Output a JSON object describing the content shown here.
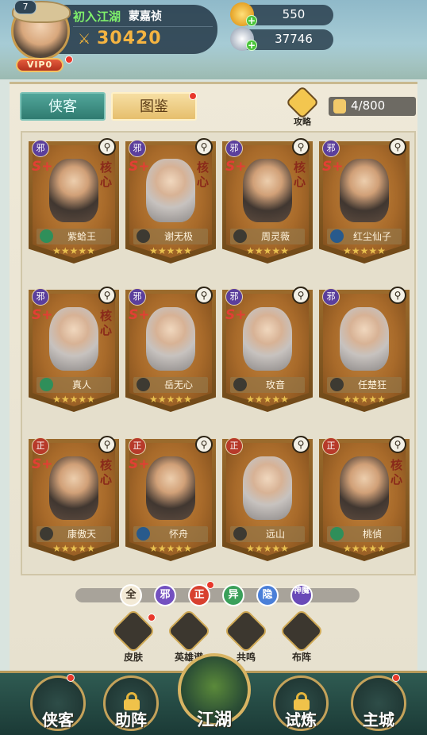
{
  "player": {
    "level": "7",
    "title": "初入江湖",
    "name": "蒙嘉祯",
    "power": "30420",
    "vip": "VIP0"
  },
  "resources": {
    "gold": "550",
    "silver": "37746"
  },
  "tabs": [
    {
      "label": "侠客",
      "active": false
    },
    {
      "label": "图鉴",
      "active": true
    }
  ],
  "guide_label": "攻略",
  "collection_count": "4/800",
  "heroes": [
    {
      "name": "紫蛤王",
      "faction": "邪",
      "grade": "S+",
      "core": "核心",
      "stars": "★★★★★"
    },
    {
      "name": "谢无极",
      "faction": "邪",
      "grade": "S+",
      "core": "核心",
      "stars": "★★★★★"
    },
    {
      "name": "周灵薇",
      "faction": "邪",
      "grade": "S+",
      "core": "核心",
      "stars": "★★★★★"
    },
    {
      "name": "红尘仙子",
      "faction": "邪",
      "grade": "S+",
      "core": "",
      "stars": "★★★★★"
    },
    {
      "name": "真人",
      "faction": "邪",
      "grade": "S+",
      "core": "核心",
      "stars": "★★★★★"
    },
    {
      "name": "岳无心",
      "faction": "邪",
      "grade": "S+",
      "core": "",
      "stars": "★★★★★"
    },
    {
      "name": "玫音",
      "faction": "邪",
      "grade": "S+",
      "core": "",
      "stars": "★★★★★"
    },
    {
      "name": "任楚狂",
      "faction": "邪",
      "grade": "",
      "core": "",
      "stars": "★★★★★"
    },
    {
      "name": "康傲天",
      "faction": "正",
      "grade": "S+",
      "core": "核心",
      "stars": "★★★★★"
    },
    {
      "name": "怀舟",
      "faction": "正",
      "grade": "S+",
      "core": "",
      "stars": "★★★★★"
    },
    {
      "name": "远山",
      "faction": "正",
      "grade": "",
      "core": "",
      "stars": "★★★★★"
    },
    {
      "name": "桃偵",
      "faction": "正",
      "grade": "",
      "core": "核心",
      "stars": "★★★★★"
    }
  ],
  "filters": [
    {
      "label": "全",
      "color": "#f3ead6",
      "text": "#3a2f22"
    },
    {
      "label": "邪",
      "color": "#7350c0",
      "text": "#ffffff"
    },
    {
      "label": "正",
      "color": "#d8402f",
      "text": "#ffffff"
    },
    {
      "label": "异",
      "color": "#3aa05a",
      "text": "#ffffff"
    },
    {
      "label": "隐",
      "color": "#4a7fd8",
      "text": "#ffffff"
    },
    {
      "label": "神魔",
      "color": "#6a4ab8",
      "text": "#ffffff"
    }
  ],
  "functions": [
    {
      "label": "皮肤"
    },
    {
      "label": "英雄谱"
    },
    {
      "label": "共鸣"
    },
    {
      "label": "布阵"
    }
  ],
  "nav": [
    {
      "label": "侠客"
    },
    {
      "label": "助阵"
    },
    {
      "label": "江湖"
    },
    {
      "label": "试炼"
    },
    {
      "label": "主城"
    }
  ],
  "icons": {
    "power": "crossed-swords-icon",
    "search": "magnifier-icon",
    "gold": "gold-ingot-icon",
    "silver": "silver-ingot-icon"
  }
}
